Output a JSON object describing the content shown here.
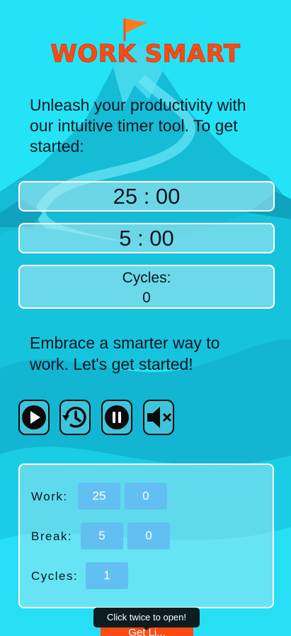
{
  "brand": {
    "title": "WORK SMART",
    "accent": "#ff4a14"
  },
  "intro": {
    "text": "Unleash your productivity with our intuitive timer tool. To get started:"
  },
  "timers": {
    "work_display": "25 : 00",
    "break_display": "5 : 00",
    "cycles_label": "Cycles:",
    "cycles_value": "0"
  },
  "embrace": {
    "text": "Embrace a smarter way to work. Let's get started!"
  },
  "controls": [
    {
      "icon": "play-icon"
    },
    {
      "icon": "reset-history-icon"
    },
    {
      "icon": "pause-icon"
    },
    {
      "icon": "mute-icon"
    }
  ],
  "settings": {
    "work_label": "Work:",
    "work_minutes": "25",
    "work_seconds": "0",
    "break_label": "Break:",
    "break_minutes": "5",
    "break_seconds": "0",
    "cycles_label": "Cycles:",
    "cycles_count": "1"
  },
  "tooltip": {
    "text": "Click twice to open!"
  },
  "start_button": {
    "label": "Get Li..."
  }
}
